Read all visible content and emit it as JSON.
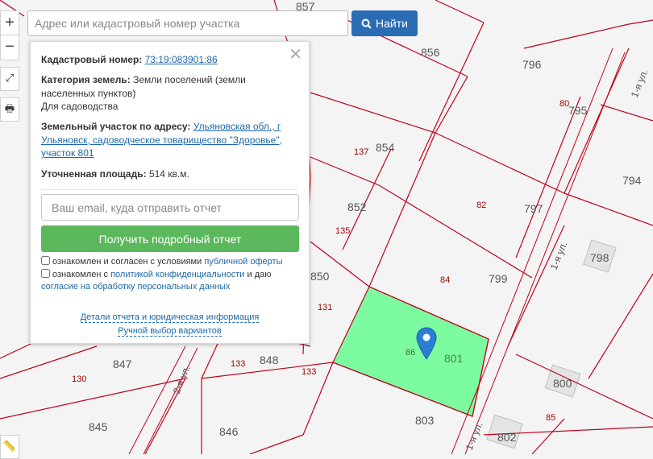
{
  "search": {
    "placeholder": "Адрес или кадастровый номер участка",
    "button_label": "Найти"
  },
  "map_controls": {
    "zoom_in": "+",
    "zoom_out": "−"
  },
  "popup": {
    "cadastral_label": "Кадастровый номер:",
    "cadastral_value": "73:19:083901:86",
    "category_label": "Категория земель:",
    "category_value": "Земли поселений (земли населенных пунктов)",
    "usage_value": "Для садоводства",
    "address_label": "Земельный участок по адресу:",
    "address_value": "Ульяновская обл., г Ульяновск, садоводческое товарищество \"Здоровье\", участок 801",
    "area_label": "Уточненная площадь:",
    "area_value": "514 кв.м.",
    "email_placeholder": "Ваш email, куда отправить отчет",
    "report_button": "Получить подробный отчет",
    "consent1_text": "ознакомлен и согласен с условиями ",
    "consent1_link": "публичной оферты",
    "consent2_text": "ознакомлен с ",
    "consent2_link": "политикой конфиденциальности",
    "consent2_mid": " и даю",
    "consent2_link2": "согласие на обработку персональных данных",
    "details_link": "Детали отчета и юридическая информация",
    "manual_link": "Ручной выбор вариантов"
  },
  "map": {
    "colors": {
      "boundary": "#c0001a",
      "selected_fill": "#7dfba0",
      "marker": "#2a7fd4",
      "background": "#f4f4f4"
    },
    "street_labels": [
      "1-я ул.",
      "1-я ул.",
      "2-я ул.",
      "1-я ул."
    ],
    "parcel_numbers": [
      "857",
      "856",
      "796",
      "795",
      "854",
      "794",
      "852",
      "797",
      "798",
      "850",
      "799",
      "801",
      "848",
      "847",
      "846",
      "845",
      "803",
      "800",
      "802"
    ],
    "parcel_codes": [
      "80",
      "137",
      "82",
      "135",
      "84",
      "131",
      "86",
      "133",
      "133",
      "130",
      "85"
    ],
    "selected_parcel": "801",
    "marker_icon": "map-marker-icon"
  }
}
